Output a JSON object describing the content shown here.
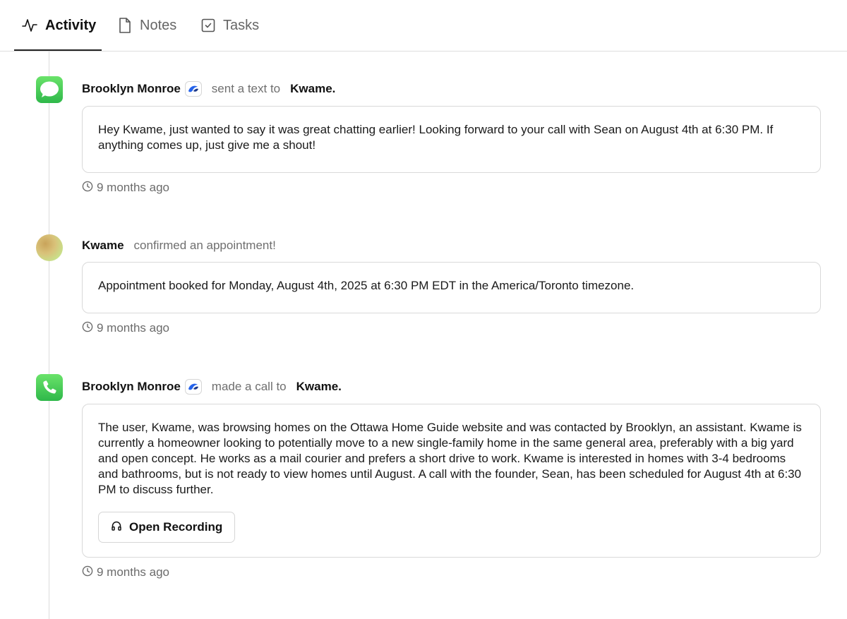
{
  "tabs": [
    {
      "label": "Activity",
      "icon": "activity-icon",
      "active": true
    },
    {
      "label": "Notes",
      "icon": "document-icon",
      "active": false
    },
    {
      "label": "Tasks",
      "icon": "checkbox-icon",
      "active": false
    }
  ],
  "colors": {
    "accent_green": "#34c759",
    "muted_text": "#6f6f6f",
    "border": "#d9d9d9",
    "bot_blue": "#2563eb"
  },
  "entries": [
    {
      "icon": "message-bubble-icon",
      "actor": "Brooklyn Monroe",
      "verb": "sent a text to",
      "target": "Kwame.",
      "body": "Hey Kwame, just wanted to say it was great chatting earlier! Looking forward to your call with Sean on August 4th at 6:30 PM. If anything comes up, just give me a shout!",
      "time": "9 months ago"
    },
    {
      "icon": "avatar",
      "actor": "Kwame",
      "verb": "confirmed an appointment!",
      "body": "Appointment booked for Monday, August 4th, 2025 at 6:30 PM EDT in the America/Toronto timezone.",
      "time": "9 months ago"
    },
    {
      "icon": "phone-icon",
      "actor": "Brooklyn Monroe",
      "verb": "made a call to",
      "target": "Kwame.",
      "body": "The user, Kwame, was browsing homes on the Ottawa Home Guide website and was contacted by Brooklyn, an assistant. Kwame is currently a homeowner looking to potentially move to a new single-family home in the same general area, preferably with a big yard and open concept. He works as a mail courier and prefers a short drive to work. Kwame is interested in homes with 3-4 bedrooms and bathrooms, but is not ready to view homes until August. A call with the founder, Sean, has been scheduled for August 4th at 6:30 PM to discuss further.",
      "button_label": "Open Recording",
      "time": "9 months ago"
    }
  ]
}
